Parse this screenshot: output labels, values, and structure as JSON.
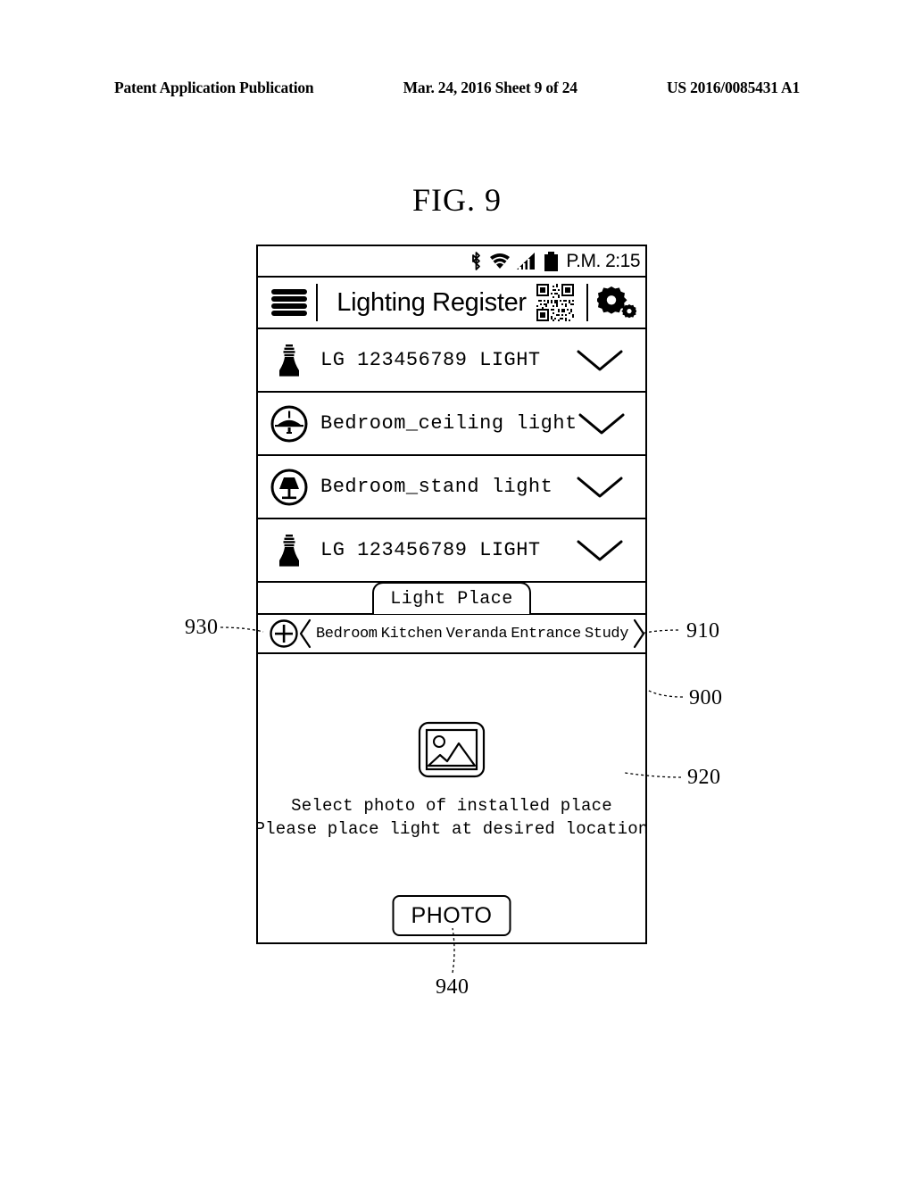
{
  "page_header": {
    "left": "Patent Application Publication",
    "middle": "Mar. 24, 2016  Sheet 9 of 24",
    "right": "US 2016/0085431 A1"
  },
  "figure": {
    "title": "FIG. 9"
  },
  "phone": {
    "status_bar": {
      "icons": [
        "bluetooth-icon",
        "wifi-icon",
        "signal-icon",
        "battery-icon"
      ],
      "time": "P.M. 2:15"
    },
    "title_bar": {
      "menu_icon": "hamburger-menu-icon",
      "title": "Lighting Register",
      "qr_icon": "qr-code-icon",
      "settings_icon": "gear-icon"
    },
    "device_list": [
      {
        "icon": "light-bulb-icon",
        "label": "LG 123456789 LIGHT",
        "expand_icon": "chevron-down-icon"
      },
      {
        "icon": "ceiling-light-icon",
        "label": "Bedroom_ceiling light",
        "expand_icon": "chevron-down-icon"
      },
      {
        "icon": "stand-lamp-icon",
        "label": "Bedroom_stand light",
        "expand_icon": "chevron-down-icon"
      },
      {
        "icon": "light-bulb-icon",
        "label": "LG 123456789 LIGHT",
        "expand_icon": "chevron-down-icon"
      }
    ],
    "light_place": {
      "tab_label": "Light Place",
      "add_icon": "plus-circle-icon",
      "scroll_left_icon": "chevron-left-icon",
      "scroll_right_icon": "chevron-right-icon",
      "categories": [
        "Bedroom",
        "Kitchen",
        "Veranda",
        "Entrance",
        "Study"
      ]
    },
    "photo_area": {
      "placeholder_icon": "image-placeholder-icon",
      "instruction_line1": "Select photo of installed place",
      "instruction_line2": "Please place light at desired location",
      "photo_button_label": "PHOTO"
    }
  },
  "callouts": {
    "c930": "930",
    "c910": "910",
    "c900": "900",
    "c920": "920",
    "c940": "940"
  }
}
